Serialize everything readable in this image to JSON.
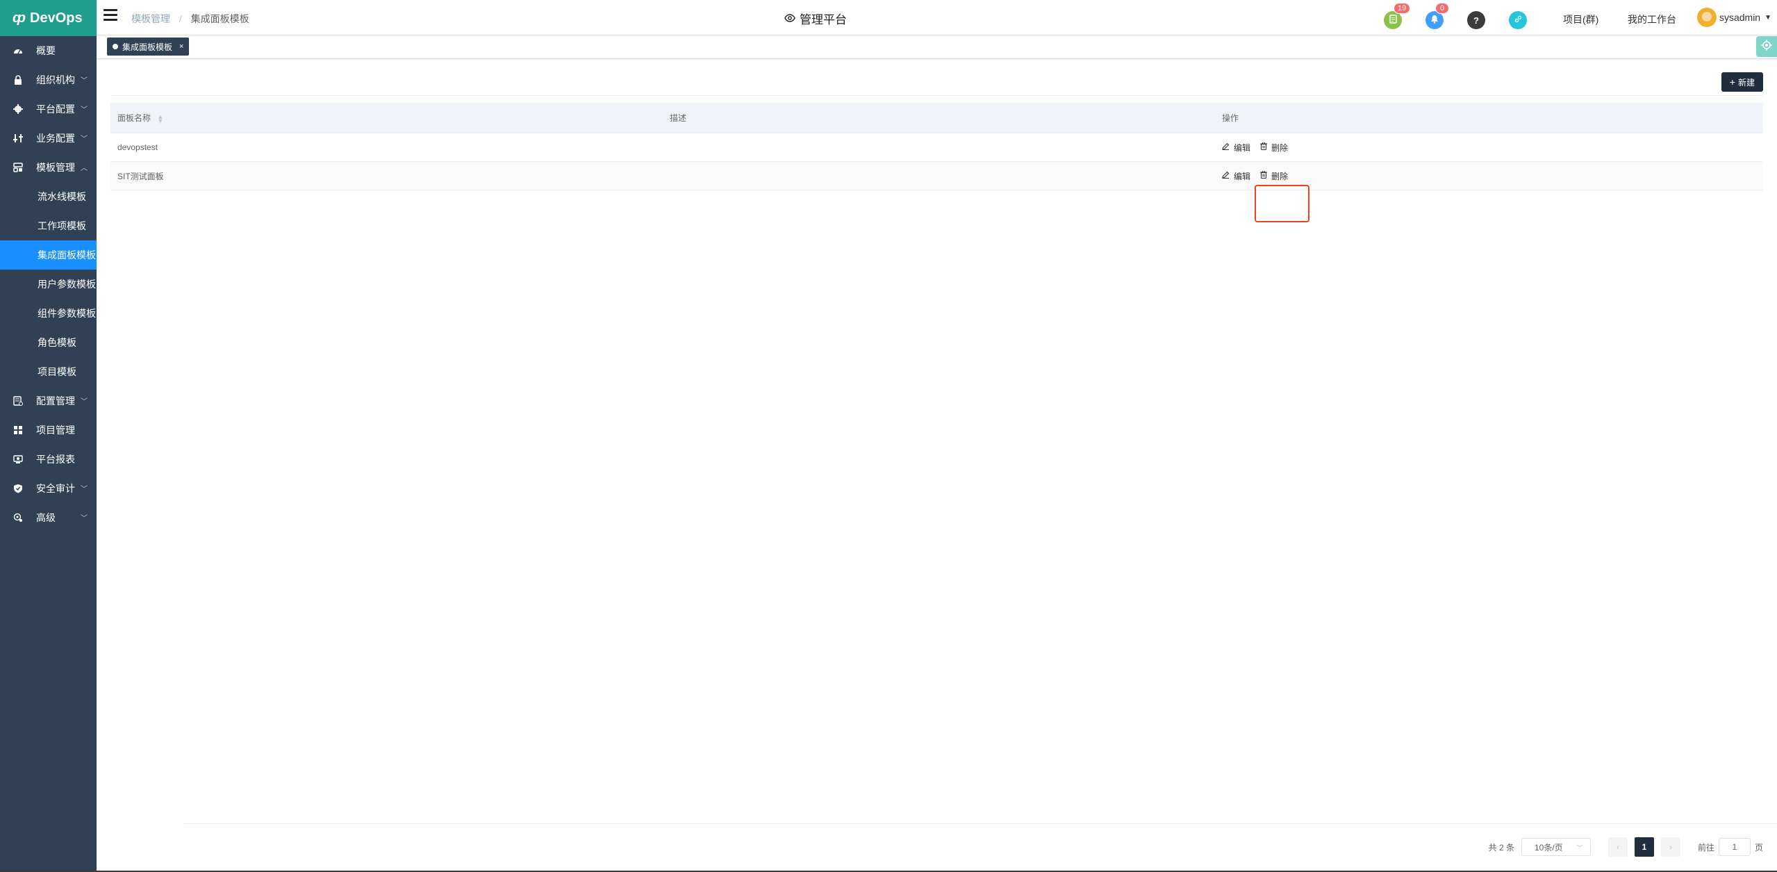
{
  "sidebar": {
    "logo_mark": "ȹ",
    "logo_text": "DevOps",
    "items": [
      {
        "label": "概要",
        "icon": "dashboard-icon"
      },
      {
        "label": "组织机构",
        "icon": "lock-icon"
      },
      {
        "label": "平台配置",
        "icon": "gear-icon"
      },
      {
        "label": "业务配置",
        "icon": "sliders-icon"
      },
      {
        "label": "模板管理",
        "icon": "template-icon"
      },
      {
        "label": "流水线模板"
      },
      {
        "label": "工作项模板"
      },
      {
        "label": "集成面板模板"
      },
      {
        "label": "用户参数模板"
      },
      {
        "label": "组件参数模板"
      },
      {
        "label": "角色模板"
      },
      {
        "label": "项目模板"
      },
      {
        "label": "配置管理",
        "icon": "config-icon"
      },
      {
        "label": "项目管理",
        "icon": "grid-icon"
      },
      {
        "label": "平台报表",
        "icon": "report-icon"
      },
      {
        "label": "安全审计",
        "icon": "shield-icon"
      },
      {
        "label": "高级",
        "icon": "advanced-icon"
      }
    ]
  },
  "header": {
    "breadcrumb_parent": "模板管理",
    "breadcrumb_sep": "/",
    "breadcrumb_current": "集成面板模板",
    "title": "管理平台",
    "badge_notes": "19",
    "badge_bell": "0",
    "link_project": "项目(群)",
    "link_workbench": "我的工作台",
    "username": "sysadmin",
    "colors": {
      "notes": "#8bc34a",
      "bell": "#409eff",
      "help": "#3c3c3c",
      "link": "#26c6da"
    }
  },
  "tags": {
    "active_tag": "集成面板模板",
    "close": "×"
  },
  "toolbar": {
    "new_label": "新建"
  },
  "table": {
    "columns": [
      "面板名称",
      "描述",
      "操作"
    ],
    "actions": {
      "edit": "编辑",
      "delete": "删除"
    },
    "rows": [
      {
        "name": "devopstest",
        "description": ""
      },
      {
        "name": "SIT测试面板",
        "description": ""
      }
    ]
  },
  "pagination": {
    "total": "共 2 条",
    "page_size": "10条/页",
    "current_page": "1",
    "goto_label": "前往",
    "goto_value": "1",
    "page_unit": "页"
  },
  "highlight": {
    "color": "#e8451e"
  }
}
